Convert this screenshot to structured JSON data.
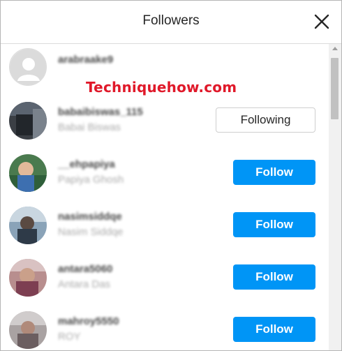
{
  "dialog": {
    "title": "Followers",
    "close_icon": "close-icon"
  },
  "watermark": "Techniquehow.com",
  "followers": [
    {
      "username": "arabraake9",
      "fullname": "",
      "button": "",
      "avatar": "default-avatar-icon"
    },
    {
      "username": "babaibiswas_115",
      "fullname": "Babai Biswas",
      "button": "Following",
      "avatar": "photo"
    },
    {
      "username": "__ehpapiya",
      "fullname": "Papiya Ghosh",
      "button": "Follow",
      "avatar": "photo"
    },
    {
      "username": "nasimsiddqe",
      "fullname": "Nasim Siddqe",
      "button": "Follow",
      "avatar": "photo"
    },
    {
      "username": "antara5060",
      "fullname": "Antara Das",
      "button": "Follow",
      "avatar": "photo"
    },
    {
      "username": "mahroy5550",
      "fullname": "ROY",
      "button": "Follow",
      "avatar": "photo"
    }
  ],
  "colors": {
    "follow_button": "#0095f6",
    "watermark": "#e0192a",
    "title_text": "#262626",
    "secondary_text": "#8e8e8e"
  }
}
